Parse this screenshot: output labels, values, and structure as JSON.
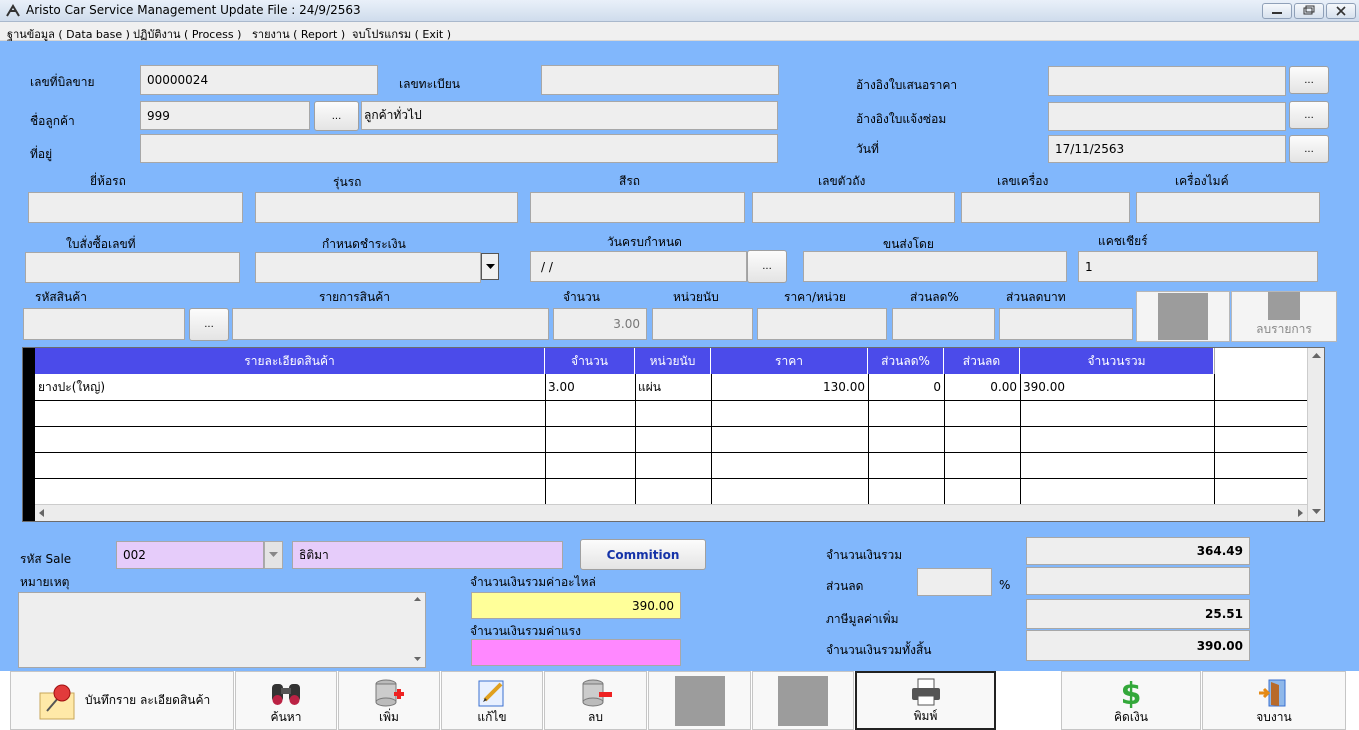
{
  "window": {
    "title": "Aristo Car Service Management   Update File : 24/9/2563"
  },
  "menu": [
    "ฐานข้อมูล ( Data base )",
    "ปฏิบัติงาน ( Process )",
    "รายงาน ( Report )",
    "จบโปรแกรม ( Exit )"
  ],
  "header": {
    "bill_no_label": "เลขที่บิลขาย",
    "bill_no": "00000024",
    "plate_label": "เลขทะเบียน",
    "plate": "",
    "quote_ref_label": "อ้างอิงใบเสนอราคา",
    "quote_ref": "",
    "customer_label": "ชื่อลูกค้า",
    "customer_code": "999",
    "customer_name": "ลูกค้าทั่วไป",
    "repair_ref_label": "อ้างอิงใบแจ้งซ่อม",
    "repair_ref": "",
    "address_label": "ที่อยู่",
    "address": "",
    "date_label": "วันที่",
    "date": "17/11/2563",
    "browse": "..."
  },
  "vehicle": {
    "brand_label": "ยี่ห้อรถ",
    "model_label": "รุ่นรถ",
    "color_label": "สีรถ",
    "chassis_label": "เลขตัวถัง",
    "engine_label": "เลขเครื่อง",
    "mileage_label": "เครื่องไมค์"
  },
  "order": {
    "po_label": "ใบสั่งซื้อเลขที่",
    "payment_label": "กำหนดชำระเงิน",
    "due_label": "วันครบกำหนด",
    "due": " /  /",
    "ship_label": "ขนส่งโดย",
    "cashier_label": "แคชเชียร์",
    "cashier": "1"
  },
  "item_entry": {
    "code_label": "รหัสสินค้า",
    "desc_label": "รายการสินค้า",
    "qty_label": "จำนวน",
    "unit_label": "หน่วยนับ",
    "price_label": "ราคา/หน่วย",
    "disc_pct_label": "ส่วนลด%",
    "disc_amt_label": "ส่วนลดบาท",
    "qty": "3.00",
    "delete_label": "ลบรายการ"
  },
  "grid": {
    "columns": [
      "รายละเอียดสินค้า",
      "จำนวน",
      "หน่วยนับ",
      "ราคา",
      "ส่วนลด%",
      "ส่วนลด",
      "จำนวนรวม"
    ],
    "rows": [
      [
        "ยางปะ(ใหญ่)",
        "3.00",
        "แผ่น",
        "130.00",
        "0",
        "0.00",
        "390.00"
      ]
    ]
  },
  "sale": {
    "code_label": "รหัส Sale",
    "code": "002",
    "name": "ธิติมา",
    "commission_label": "Commition",
    "note_label": "หมายเหตุ",
    "parts_total_label": "จำนวนเงินรวมค่าอะไหล่",
    "parts_total": "390.00",
    "labor_total_label": "จำนวนเงินรวมค่าแรง",
    "labor_total": ""
  },
  "totals": {
    "subtotal_label": "จำนวนเงินรวม",
    "subtotal": "364.49",
    "discount_label": "ส่วนลด",
    "pct": "%",
    "discount": "",
    "vat_label": "ภาษีมูลค่าเพิ่ม",
    "vat": "25.51",
    "grand_label": "จำนวนเงินรวมทั้งสิ้น",
    "grand": "390.00"
  },
  "toolbar": {
    "save": "บันทึกราย ละเอียดสินค้า",
    "search": "ค้นหา",
    "add": "เพิ่ม",
    "edit": "แก้ไข",
    "delete": "ลบ",
    "print": "พิมพ์",
    "pay": "คิดเงิน",
    "exit": "จบงาน"
  },
  "colors": {
    "background": "#81b7fc",
    "grid_header": "#4b4bea",
    "sale_field": "#e6ccfa",
    "parts_total": "#ffff99",
    "labor_total": "#ff88ff"
  }
}
